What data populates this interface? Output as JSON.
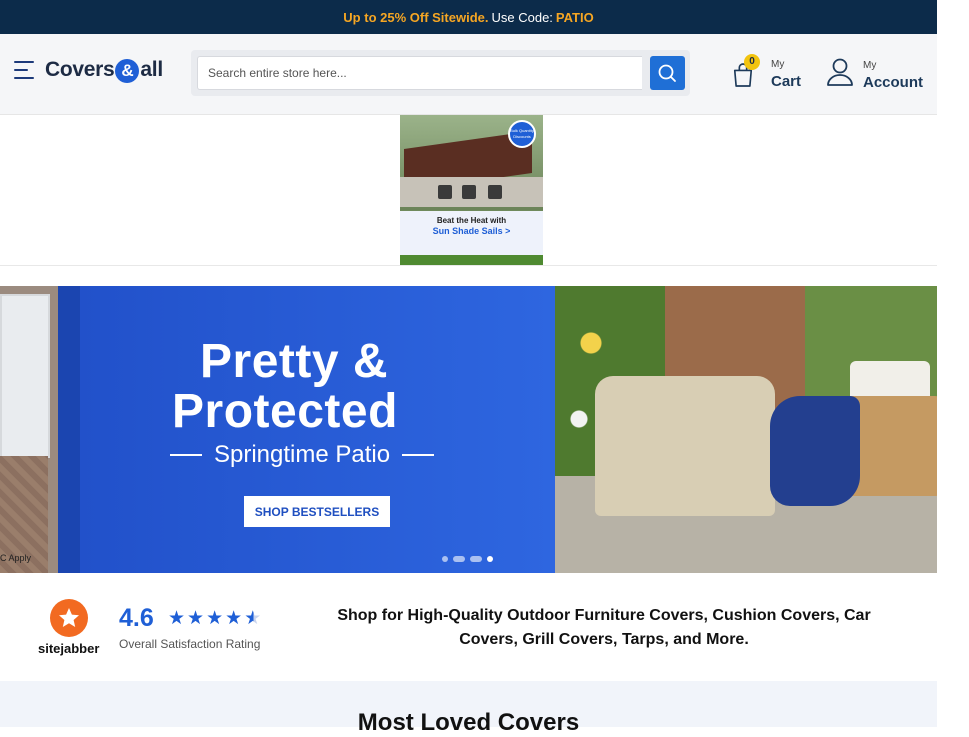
{
  "promo": {
    "offer": "Up to 25% Off Sitewide.",
    "use_code": "Use Code:",
    "code": "PATIO"
  },
  "header": {
    "logo_text": {
      "part1": "Covers",
      "amp": "&",
      "part2": "all"
    },
    "search": {
      "placeholder": "Search entire store here..."
    },
    "cart": {
      "small": "My",
      "big": "Cart",
      "count": "0"
    },
    "account": {
      "small": "My",
      "big": "Account"
    }
  },
  "ad": {
    "seal_text": "Bulk Quantity Discounts",
    "line1": "Beat the Heat with",
    "line2": "Sun Shade Sails >"
  },
  "hero": {
    "title_line1": "Pretty &",
    "title_line2": "Protected",
    "subtitle": "Springtime Patio",
    "cta": "SHOP BESTSELLERS",
    "left_peek_text": "C Apply",
    "slide_count": 4,
    "active_slide": 4
  },
  "rating": {
    "brand": "sitejabber",
    "score": "4.6",
    "stars": 4.6,
    "label": "Overall Satisfaction Rating",
    "tagline": "Shop for High-Quality Outdoor Furniture Covers, Cushion Covers, Car Covers, Grill Covers, Tarps, and More."
  },
  "section": {
    "heading": "Most Loved Covers"
  },
  "colors": {
    "navy": "#0c2b4a",
    "accent_orange": "#f6a623",
    "brand_blue": "#1f5fd6",
    "sitejabber_orange": "#f26a21"
  }
}
